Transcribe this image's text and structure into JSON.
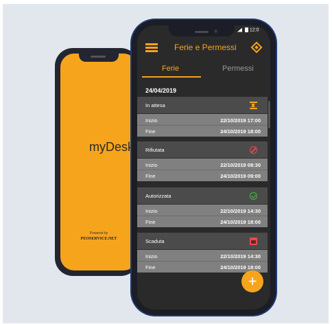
{
  "back_phone": {
    "brand": "myDesk",
    "powered_by": "Powered by",
    "powered_brand": "PEOSERVICE.NET"
  },
  "status_bar": {
    "time": "12:0"
  },
  "app": {
    "title": "Ferie e Permessi",
    "menu_icon": "hamburger-menu-icon",
    "action_icon": "diamond-icon",
    "accent_color": "#f7a41d"
  },
  "tabs": [
    {
      "label": "Ferie",
      "active": true
    },
    {
      "label": "Permessi",
      "active": false
    }
  ],
  "date": "24/04/2019",
  "requests": [
    {
      "status": "In attesa",
      "icon": "hourglass-icon",
      "start_label": "Inizio",
      "start": "22/10/2019 17:00",
      "end_label": "Fine",
      "end": "24/10/2019 18:00"
    },
    {
      "status": "Rifiutata",
      "icon": "ban-icon",
      "start_label": "Inizio",
      "start": "22/10/2019 08:30",
      "end_label": "Fine",
      "end": "24/10/2019 09:00"
    },
    {
      "status": "Autorizzata",
      "icon": "check-circle-icon",
      "start_label": "Inizio",
      "start": "22/10/2019 14:30",
      "end_label": "Fine",
      "end": "24/10/2019 18:00"
    },
    {
      "status": "Scaduta",
      "icon": "calendar-expired-icon",
      "start_label": "Inizio",
      "start": "22/10/2019 14:30",
      "end_label": "Fine",
      "end": "24/10/2019 18:00"
    }
  ],
  "fab": {
    "label": "+",
    "icon": "plus-icon"
  }
}
